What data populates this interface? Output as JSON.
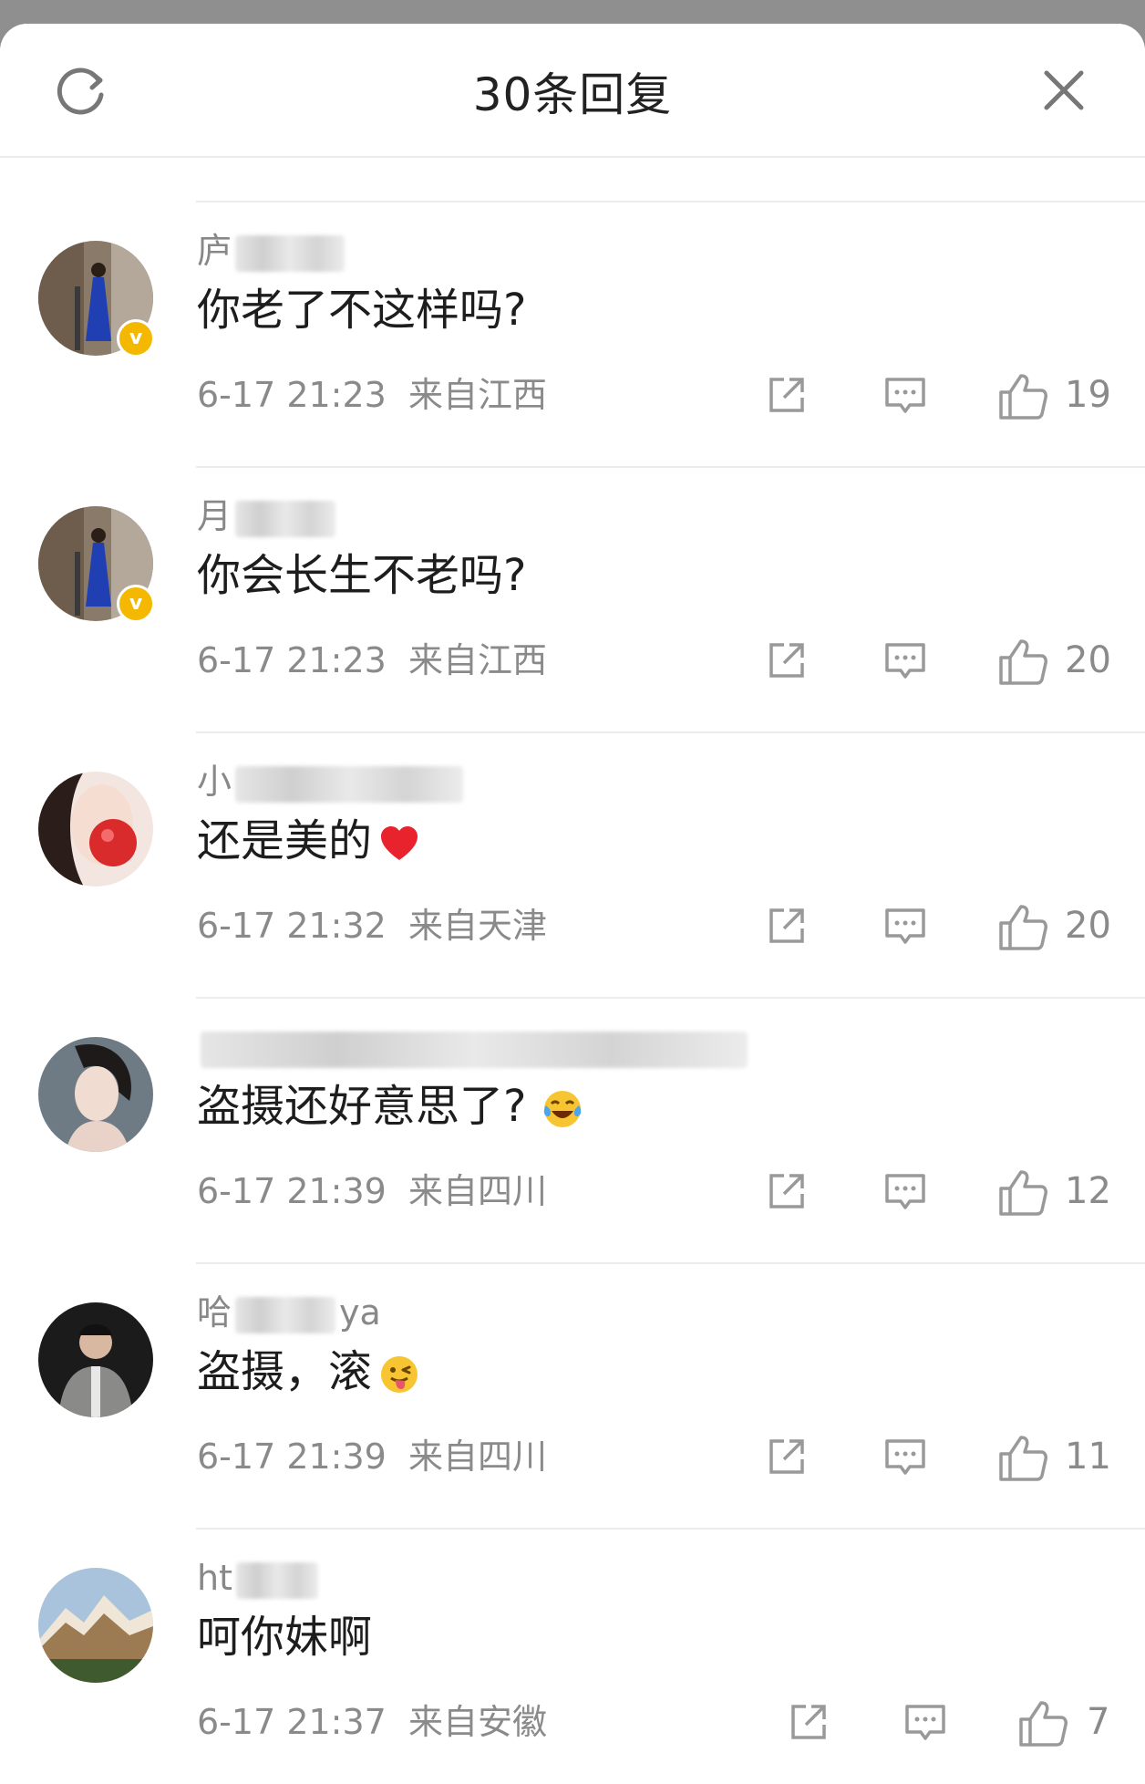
{
  "header": {
    "title": "30条回复",
    "refresh_icon": "refresh-icon",
    "close_icon": "close-icon"
  },
  "colors": {
    "badge": "#f5b800",
    "meta": "#8a8a8a",
    "text": "#1d1d1d",
    "heart": "#e8232e"
  },
  "comments": [
    {
      "username_visible": "庐",
      "text": "你老了不这样吗?",
      "date": "6-17 21:23",
      "location": "来自江西",
      "likes": "19",
      "verified": true
    },
    {
      "username_visible": "月",
      "text": "你会长生不老吗?",
      "date": "6-17 21:23",
      "location": "来自江西",
      "likes": "20",
      "verified": true
    },
    {
      "username_visible": "小",
      "text": "还是美的",
      "emoji": "heart-emoji",
      "date": "6-17 21:32",
      "location": "来自天津",
      "likes": "20",
      "verified": false
    },
    {
      "username_visible": "",
      "text": "盗摄还好意思了?",
      "emoji": "crying-laughing-emoji",
      "date": "6-17 21:39",
      "location": "来自四川",
      "likes": "12",
      "verified": false
    },
    {
      "username_visible": "哈",
      "username_suffix": "ya",
      "text": "盗摄，滚",
      "emoji": "tongue-wink-emoji",
      "date": "6-17 21:39",
      "location": "来自四川",
      "likes": "11",
      "verified": false
    },
    {
      "username_visible": "ht",
      "text": "呵你妹啊",
      "date": "6-17 21:37",
      "location": "来自安徽",
      "likes": "7",
      "verified": false
    }
  ]
}
